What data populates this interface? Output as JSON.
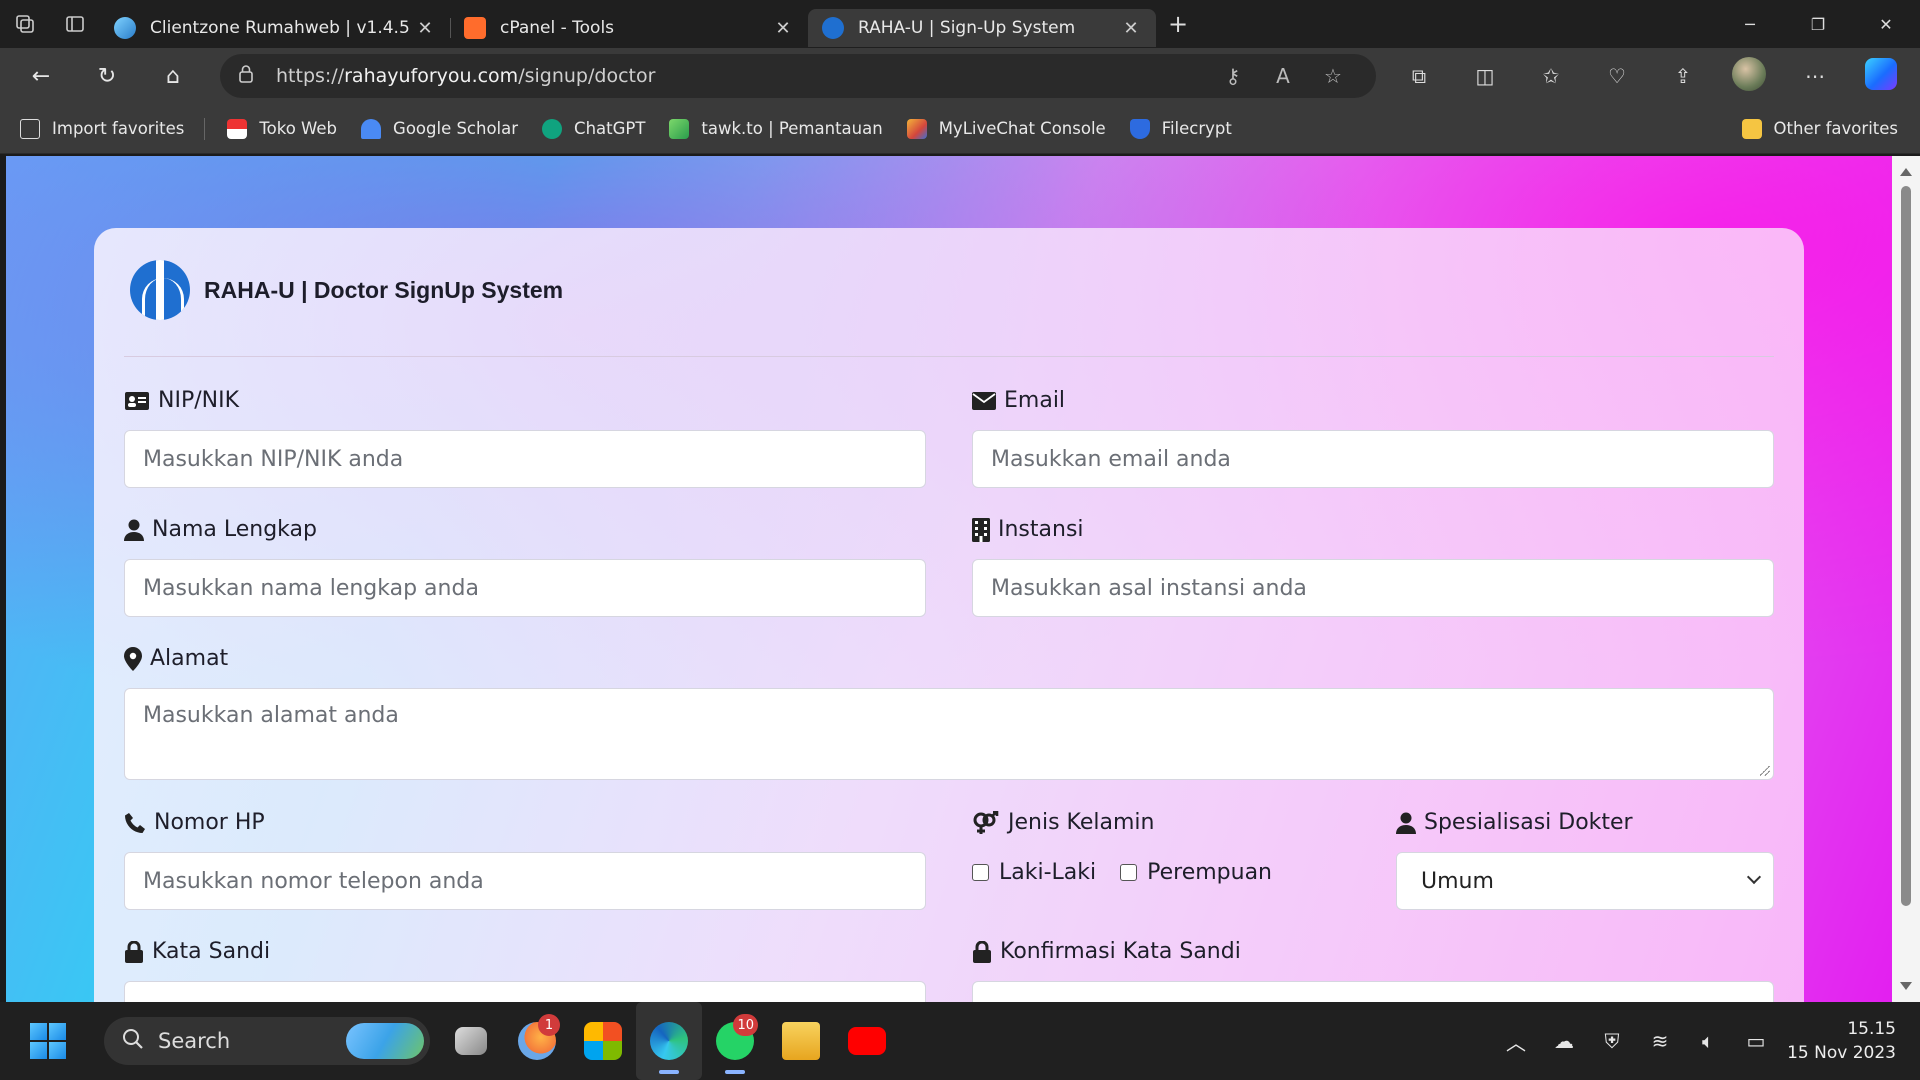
{
  "browser": {
    "tabs": [
      {
        "title": "Clientzone Rumahweb | v1.4.5",
        "icon": "rumahweb-favicon",
        "active": false
      },
      {
        "title": "cPanel - Tools",
        "icon": "cpanel-favicon",
        "active": false
      },
      {
        "title": "RAHA-U | Sign-Up System",
        "icon": "raha-u-favicon",
        "active": true
      }
    ],
    "address": {
      "url_prefix": "https://",
      "url_host": "rahayuforyou.com",
      "url_path": "/signup/doctor"
    },
    "bookmarks": [
      {
        "label": "Import favorites",
        "icon": "import-icon"
      },
      {
        "label": "Toko Web",
        "icon": "tokoweb-icon"
      },
      {
        "label": "Google Scholar",
        "icon": "scholar-icon"
      },
      {
        "label": "ChatGPT",
        "icon": "chatgpt-icon"
      },
      {
        "label": "tawk.to | Pemantauan",
        "icon": "tawkto-icon"
      },
      {
        "label": "MyLiveChat Console",
        "icon": "mylivechat-icon"
      },
      {
        "label": "Filecrypt",
        "icon": "filecrypt-icon"
      }
    ],
    "other_favorites": "Other favorites"
  },
  "form": {
    "title": "RAHA-U | Doctor SignUp System",
    "nip": {
      "label": "NIP/NIK",
      "placeholder": "Masukkan NIP/NIK anda"
    },
    "email": {
      "label": "Email",
      "placeholder": "Masukkan email anda"
    },
    "nama": {
      "label": "Nama Lengkap",
      "placeholder": "Masukkan nama lengkap anda"
    },
    "instansi": {
      "label": "Instansi",
      "placeholder": "Masukkan asal instansi anda"
    },
    "alamat": {
      "label": "Alamat",
      "placeholder": "Masukkan alamat anda"
    },
    "hp": {
      "label": "Nomor HP",
      "placeholder": "Masukkan nomor telepon anda"
    },
    "gender": {
      "label": "Jenis Kelamin",
      "options": [
        "Laki-Laki",
        "Perempuan"
      ]
    },
    "spesialisasi": {
      "label": "Spesialisasi Dokter",
      "selected": "Umum"
    },
    "password": {
      "label": "Kata Sandi"
    },
    "confirm_password": {
      "label": "Konfirmasi Kata Sandi"
    }
  },
  "taskbar": {
    "search_label": "Search",
    "badges": {
      "weather": "1",
      "whatsapp": "10"
    },
    "time": "15.15",
    "date": "15 Nov 2023"
  },
  "colors": {
    "page_gradient": [
      "#5fa8f7",
      "#2bd3f2",
      "#c9b8f5",
      "#e36ff0",
      "#e31ff0"
    ],
    "logo_blue": "#1f6fd0"
  }
}
